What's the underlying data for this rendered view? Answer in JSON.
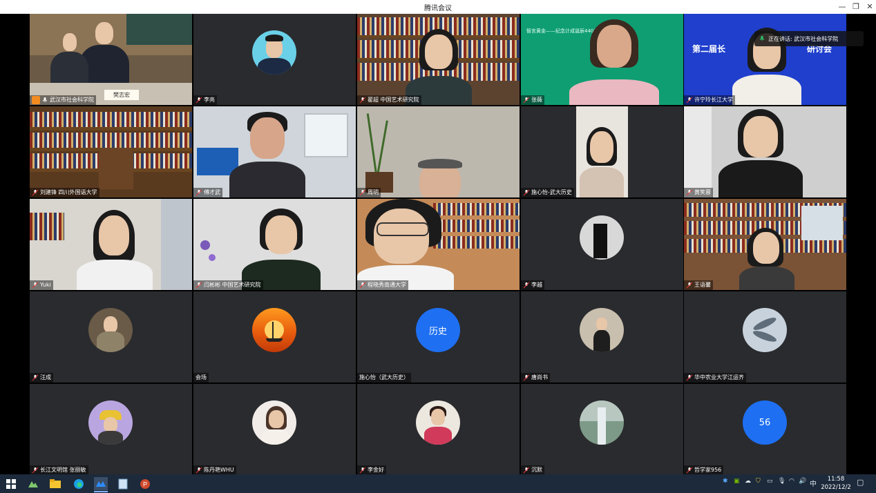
{
  "window": {
    "title": "腾讯会议"
  },
  "speaking": {
    "text": "正在讲话: 武汉市社会科学院"
  },
  "tiles": [
    {
      "name": "武汉市社会科学院"
    },
    {
      "name": "李亮"
    },
    {
      "name": "翟超 中国艺术研究院"
    },
    {
      "name": "张薇"
    },
    {
      "name": "许宁玲长江大学"
    },
    {
      "name": "刘建锋 四川外国语大学"
    },
    {
      "name": "傅才武"
    },
    {
      "name": "周明"
    },
    {
      "name": "施心怡-武大历史"
    },
    {
      "name": "黄笑蓉"
    },
    {
      "name": "Yuki"
    },
    {
      "name": "闫彬彬 中国艺术研究院"
    },
    {
      "name": "程晓秀南通大学"
    },
    {
      "name": "李越"
    },
    {
      "name": "王语馨"
    },
    {
      "name": "汪成"
    },
    {
      "name": "会场"
    },
    {
      "name": "施心怡（武大历史）",
      "avatar_text": "历史"
    },
    {
      "name": "唐尚书"
    },
    {
      "name": "华中农业大学江运齐"
    },
    {
      "name": "长江文明馆 张丽敏"
    },
    {
      "name": "陈丹艳WHU"
    },
    {
      "name": "李金好"
    },
    {
      "name": "沉默"
    },
    {
      "name": "哲学家956",
      "avatar_text": "56"
    }
  ],
  "slides": {
    "t4_header": "智言黄金——纪念计成诞辰440周年",
    "t5_title": "第二届长",
    "t5_title2": "研讨会",
    "t1_nameplate": "樊志宏"
  },
  "taskbar": {
    "ime": "中",
    "time": "11:58",
    "date": "2022/12/2"
  },
  "colors": {
    "avatar_blue": "#1e6ff2",
    "tile_bg": "#2a2b2e",
    "taskbar": "#1c2a3b"
  }
}
